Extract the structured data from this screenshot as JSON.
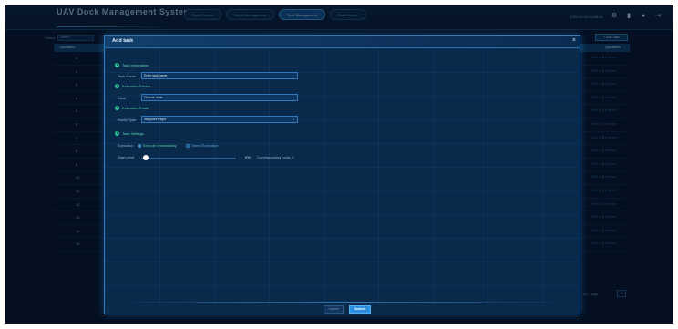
{
  "header": {
    "logo": "UAV Dock Management System",
    "nav_tabs": [
      {
        "label": "Dock Control",
        "active": false
      },
      {
        "label": "Route Management",
        "active": false
      },
      {
        "label": "Task Management",
        "active": true
      },
      {
        "label": "Data Center",
        "active": false
      }
    ],
    "datetime": "2024-01-19 11:08:31",
    "icons": [
      "settings-icon",
      "notification-icon",
      "user-icon",
      "logout-icon"
    ]
  },
  "page": {
    "filter_label": "Status",
    "filter_value": "Select",
    "add_button": "+ Add Task",
    "table": {
      "first_header": "Operations",
      "last_header": "Operations",
      "row_numbers": [
        "1",
        "2",
        "3",
        "4",
        "5",
        "6",
        "7",
        "8",
        "9",
        "10",
        "11",
        "12",
        "13",
        "14",
        "15"
      ],
      "row_actions": "Edit  Delete"
    },
    "pager": {
      "page_size": "10 / page",
      "page_box": "1"
    }
  },
  "modal": {
    "title": "Add task",
    "close_glyph": "×",
    "sections": [
      {
        "num": "1",
        "title": "Task Information"
      },
      {
        "num": "2",
        "title": "Execution Device"
      },
      {
        "num": "3",
        "title": "Execution Route"
      },
      {
        "num": "4",
        "title": "Task Settings"
      }
    ],
    "task_name": {
      "label": "Task Name",
      "placeholder": "Enter task name"
    },
    "device": {
      "label": "Dock",
      "value": "Choose dock"
    },
    "route": {
      "label": "Route Type",
      "value": "Waypoint Flight"
    },
    "execution": {
      "label": "Execution",
      "options": [
        {
          "label": "Execute Immediately",
          "checked": true
        },
        {
          "label": "Timed Execution",
          "checked": false
        }
      ]
    },
    "slider": {
      "label": "Start point",
      "value_text": "0%",
      "note": "Corresponding point: 0",
      "value": 0
    },
    "buttons": {
      "cancel": "Cancel",
      "submit": "Submit"
    }
  },
  "colors": {
    "accent": "#2d8ee0",
    "success": "#2ec79a",
    "background": "#06152b"
  }
}
